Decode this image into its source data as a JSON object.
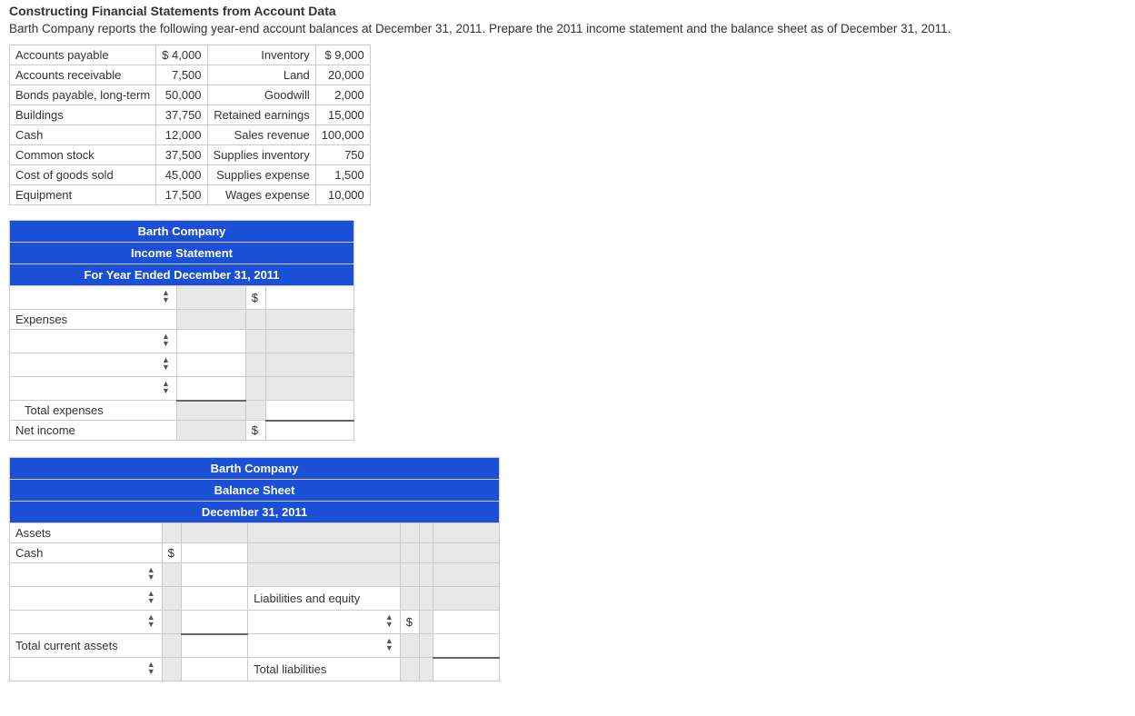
{
  "title": "Constructing Financial Statements from Account Data",
  "instructions": "Barth Company reports the following year-end account balances at December 31, 2011. Prepare the 2011 income statement and the balance sheet as of December 31, 2011.",
  "accounts": {
    "rows": [
      {
        "l1": "Accounts payable",
        "a1": "$ 4,000",
        "l2": "Inventory",
        "a2": "$ 9,000"
      },
      {
        "l1": "Accounts receivable",
        "a1": "7,500",
        "l2": "Land",
        "a2": "20,000"
      },
      {
        "l1": "Bonds payable, long-term",
        "a1": "50,000",
        "l2": "Goodwill",
        "a2": "2,000"
      },
      {
        "l1": "Buildings",
        "a1": "37,750",
        "l2": "Retained earnings",
        "a2": "15,000"
      },
      {
        "l1": "Cash",
        "a1": "12,000",
        "l2": "Sales revenue",
        "a2": "100,000"
      },
      {
        "l1": "Common stock",
        "a1": "37,500",
        "l2": "Supplies inventory",
        "a2": "750"
      },
      {
        "l1": "Cost of goods sold",
        "a1": "45,000",
        "l2": "Supplies expense",
        "a2": "1,500"
      },
      {
        "l1": "Equipment",
        "a1": "17,500",
        "l2": "Wages expense",
        "a2": "10,000"
      }
    ]
  },
  "income_statement": {
    "header1": "Barth Company",
    "header2": "Income Statement",
    "header3": "For Year Ended December 31, 2011",
    "dollar": "$",
    "labels": {
      "expenses": "Expenses",
      "total_expenses": "Total expenses",
      "net_income": "Net income"
    }
  },
  "balance_sheet": {
    "header1": "Barth Company",
    "header2": "Balance Sheet",
    "header3": "December 31, 2011",
    "dollar": "$",
    "labels": {
      "assets": "Assets",
      "cash": "Cash",
      "total_current_assets": "Total current assets",
      "liabilities_equity": "Liabilities and equity",
      "total_liabilities": "Total liabilities"
    }
  }
}
